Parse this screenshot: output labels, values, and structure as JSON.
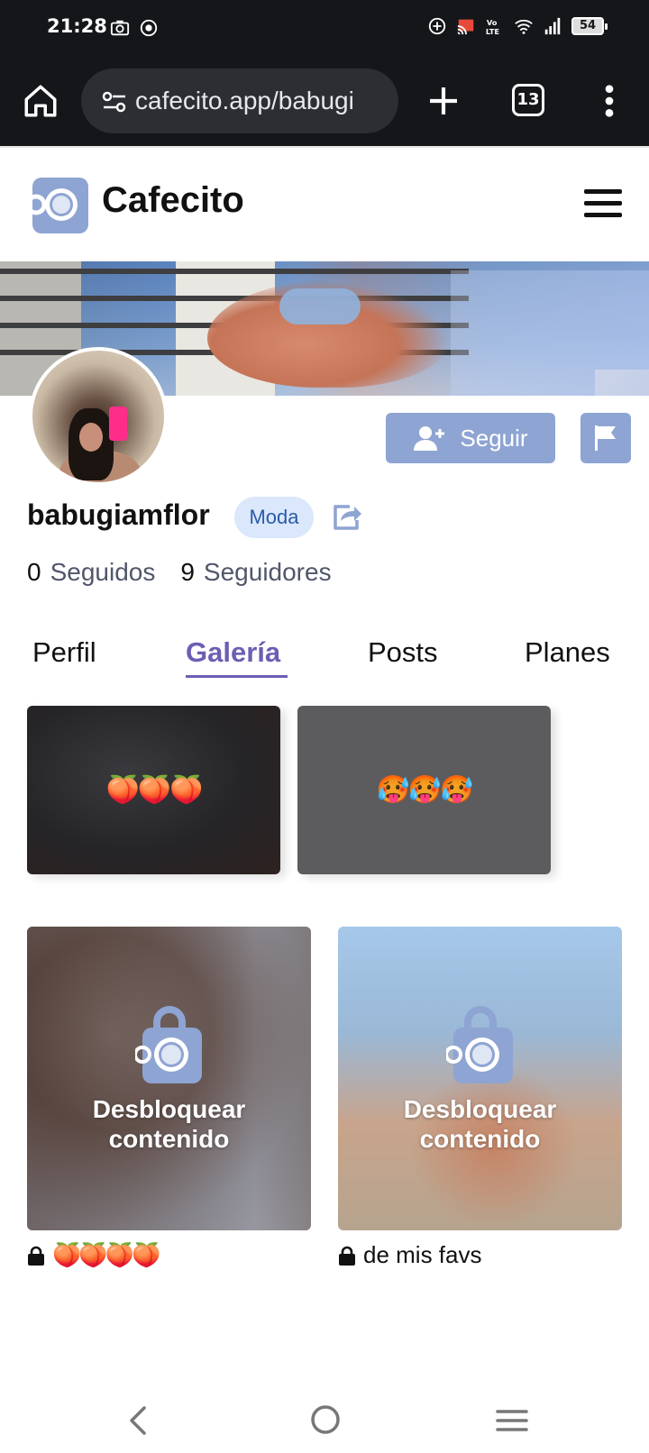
{
  "status_bar": {
    "time": "21:28",
    "battery": "54",
    "icons": [
      "camera-icon",
      "record-icon",
      "data-saver-icon",
      "cast-icon",
      "volte-icon",
      "wifi-icon",
      "signal-icon"
    ]
  },
  "browser": {
    "url": "cafecito.app/babugi",
    "tab_count": "13"
  },
  "site": {
    "brand": "Cafecito",
    "accent": "#6b5fb3",
    "button_color": "#8ea4d2"
  },
  "profile": {
    "username": "babugiamflor",
    "category": "Moda",
    "follow_label": "Seguir",
    "following_count": "0",
    "following_label": "Seguidos",
    "followers_count": "9",
    "followers_label": "Seguidores"
  },
  "tabs": [
    {
      "label": "Perfil",
      "active": false
    },
    {
      "label": "Galería",
      "active": true
    },
    {
      "label": "Posts",
      "active": false
    },
    {
      "label": "Planes",
      "active": false
    }
  ],
  "gallery": [
    {
      "caption": "🍑🍑🍑"
    },
    {
      "caption": "🥵🥵🥵"
    }
  ],
  "locked_posts": [
    {
      "overlay": "Desbloquear contenido",
      "caption": "🍑🍑🍑🍑"
    },
    {
      "overlay": "Desbloquear contenido",
      "caption": "de mis favs"
    }
  ]
}
